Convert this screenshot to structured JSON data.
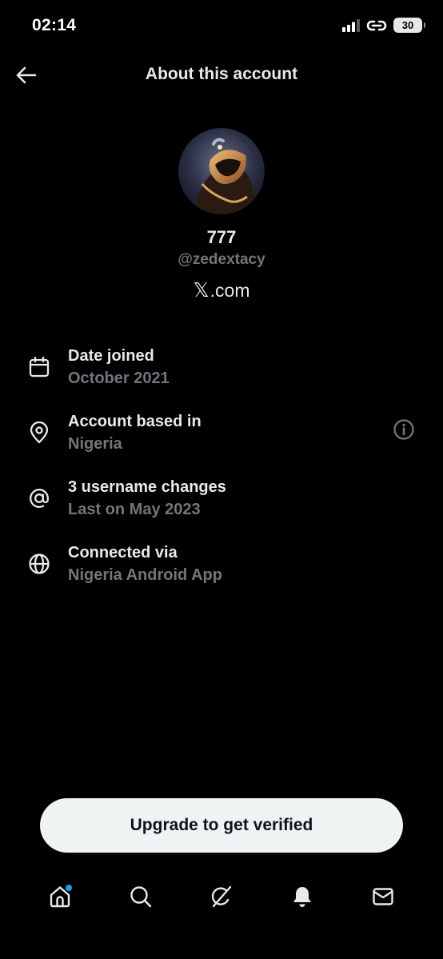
{
  "status_bar": {
    "time": "02:14",
    "battery": "30"
  },
  "header": {
    "title": "About this account",
    "back_icon": "arrow-left-icon"
  },
  "profile": {
    "display_name": "777",
    "handle": "@zedextacy",
    "site_mark": "𝕏",
    "site_suffix": ".com"
  },
  "info": {
    "date_joined": {
      "icon": "calendar-icon",
      "label": "Date joined",
      "value": "October 2021"
    },
    "based_in": {
      "icon": "location-pin-icon",
      "label": "Account based in",
      "value": "Nigeria",
      "extra_icon": "info-icon"
    },
    "username_changes": {
      "icon": "at-sign-icon",
      "label": "3 username changes",
      "value": "Last on May 2023"
    },
    "connected_via": {
      "icon": "globe-icon",
      "label": "Connected via",
      "value": "Nigeria Android App"
    }
  },
  "cta": {
    "label": "Upgrade to get verified"
  },
  "nav": {
    "items": [
      "home-icon",
      "search-icon",
      "grok-icon",
      "notifications-icon",
      "messages-icon"
    ]
  },
  "colors": {
    "background": "#000000",
    "primary_text": "#e7e9ea",
    "secondary_text": "#71767b",
    "button_bg": "#eff3f4",
    "accent": "#1d9bf0"
  }
}
